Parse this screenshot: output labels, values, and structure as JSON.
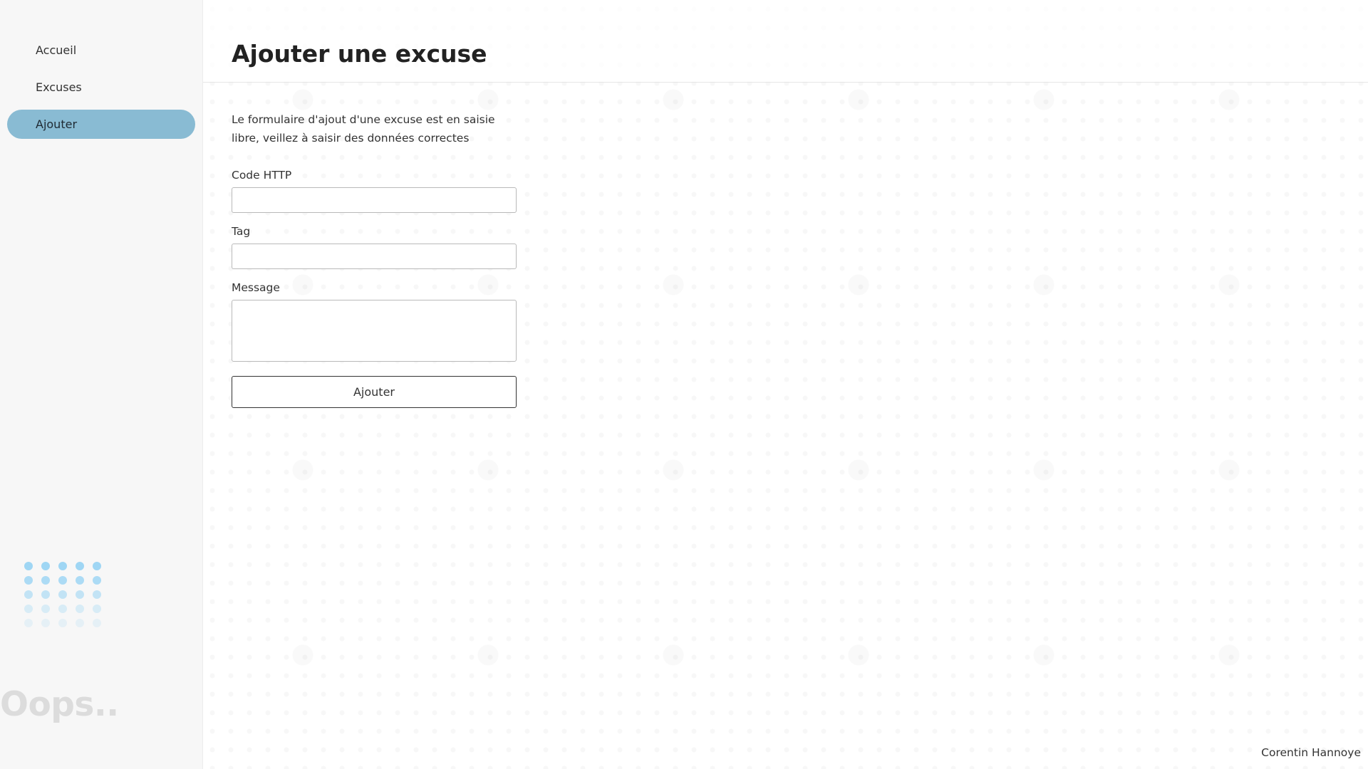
{
  "sidebar": {
    "items": [
      {
        "label": "Accueil"
      },
      {
        "label": "Excuses"
      },
      {
        "label": "Ajouter"
      }
    ],
    "brand_text": "Oops.."
  },
  "header": {
    "title": "Ajouter une excuse"
  },
  "main": {
    "intro": "Le formulaire d'ajout d'une excuse est en saisie libre, veillez à saisir des données correctes",
    "form": {
      "code_label": "Code HTTP",
      "code_value": "",
      "tag_label": "Tag",
      "tag_value": "",
      "message_label": "Message",
      "message_value": "",
      "submit_label": "Ajouter"
    }
  },
  "footer": {
    "author": "Corentin Hannoye"
  },
  "colors": {
    "active_nav": "#89bbd3",
    "dots": "#9fd6f4"
  }
}
